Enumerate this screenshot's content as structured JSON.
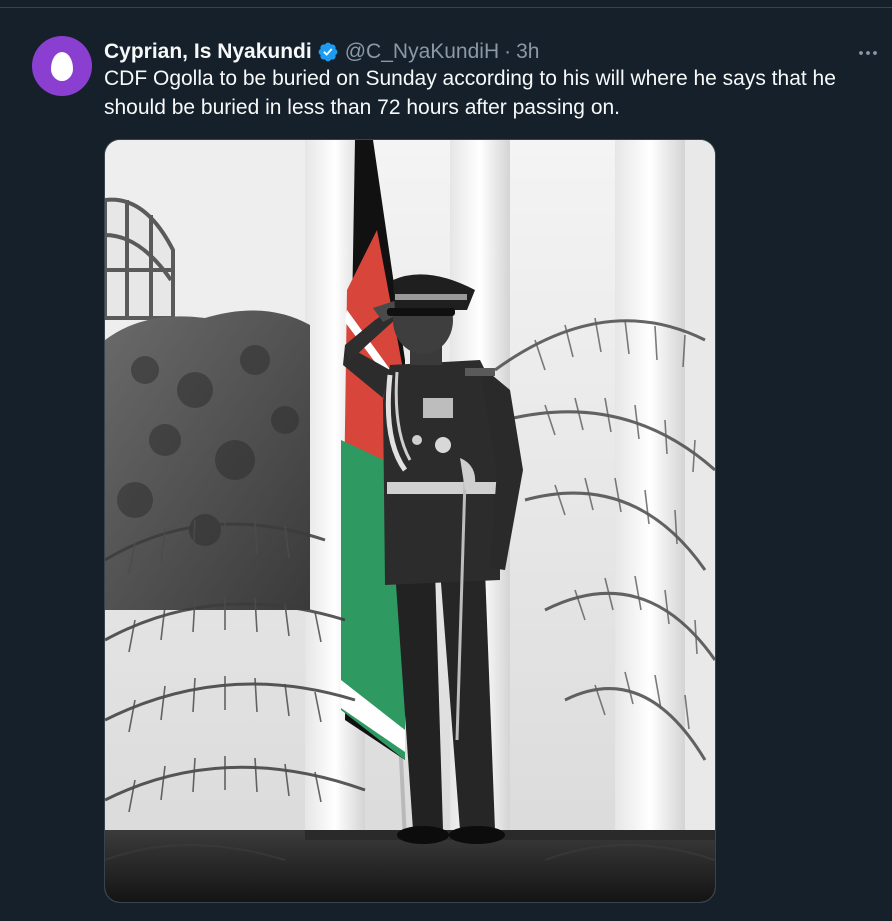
{
  "tweet": {
    "display_name": "Cyprian, Is Nyakundi",
    "handle": "@C_NyaKundiH",
    "separator": "·",
    "timestamp": "3h",
    "text": "CDF Ogolla to be buried on Sunday according to his will where he says that he should be buried in less than 72 hours after passing on.",
    "avatar_icon": "egg-icon",
    "avatar_color": "#8b3fd1",
    "verified_color": "#1d9bf0",
    "more_icon": "more-horizontal-icon"
  },
  "theme": {
    "background": "#15202b",
    "text_primary": "#f7f9f9",
    "text_secondary": "#8b98a5",
    "border": "#38444d"
  },
  "media": {
    "type": "photo",
    "flag_colors": {
      "black": "#111111",
      "red": "#d8453a",
      "green": "#2e9a62",
      "white": "#ffffff"
    }
  }
}
